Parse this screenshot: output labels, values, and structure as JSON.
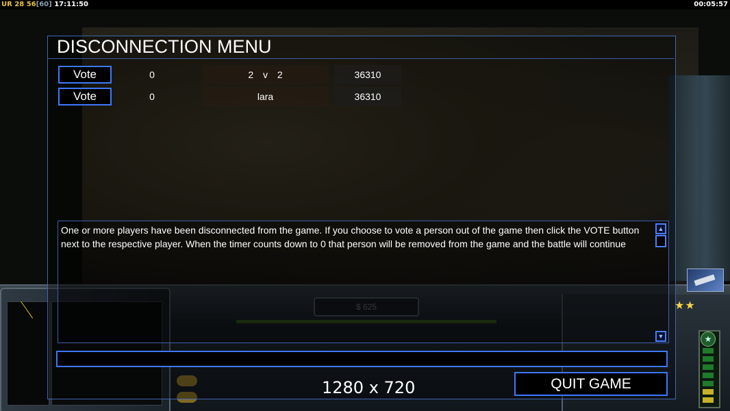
{
  "status_bar": {
    "prefix": "UR",
    "value_a": "28",
    "value_b": "56",
    "bracket": "[60]",
    "clock": "17:11:50",
    "elapsed": "00:05:57"
  },
  "dialog": {
    "title": "DISCONNECTION MENU",
    "players": [
      {
        "vote_label": "Vote",
        "votes": "0",
        "name": "2 v 2",
        "ping": "36310"
      },
      {
        "vote_label": "Vote",
        "votes": "0",
        "name": "lara",
        "ping": "36310"
      }
    ],
    "message": "One or more players have been disconnected from the game. If you choose to vote a person out of the game then click the VOTE button next to the respective player. When the timer counts down to 0 that person will be removed from the game and the battle will continue",
    "chat_value": "",
    "quit_label": "QUIT GAME"
  },
  "hud": {
    "money": "$ 625",
    "rank_stars": "★★"
  },
  "overlay_resolution": "1280 x 720",
  "colors": {
    "accent_border": "#3e78ff",
    "status_yellow": "#e8c33a",
    "panel_border": "#4466b4"
  }
}
